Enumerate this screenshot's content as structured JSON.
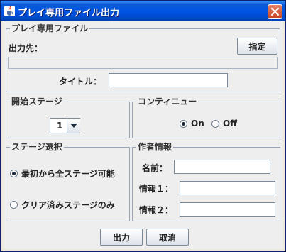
{
  "window": {
    "title": "プレイ専用ファイル出力",
    "icon": "java-cup-icon",
    "close_icon": "close-icon"
  },
  "output_group": {
    "title": "プレイ専用ファイル",
    "output_label": "出力先：",
    "browse_button": "指定",
    "output_path": "",
    "title_label": "タイトル：",
    "title_value": ""
  },
  "start_stage": {
    "title": "開始ステージ",
    "selected": "1"
  },
  "continue": {
    "title": "コンティニュー",
    "options": [
      "On",
      "Off"
    ],
    "selected": "On"
  },
  "stage_select": {
    "title": "ステージ選択",
    "options": [
      "最初から全ステージ可能",
      "クリア済みステージのみ"
    ],
    "selected": "最初から全ステージ可能"
  },
  "author": {
    "title": "作者情報",
    "name_label": "名前：",
    "name_value": "",
    "info1_label": "情報１：",
    "info1_value": "",
    "info2_label": "情報２：",
    "info2_value": ""
  },
  "footer": {
    "output_button": "出力",
    "cancel_button": "取消"
  },
  "colors": {
    "titlebar": "#0054e3",
    "background": "#eeeeee",
    "border": "#9aa4b4",
    "close_button": "#d9562d"
  }
}
